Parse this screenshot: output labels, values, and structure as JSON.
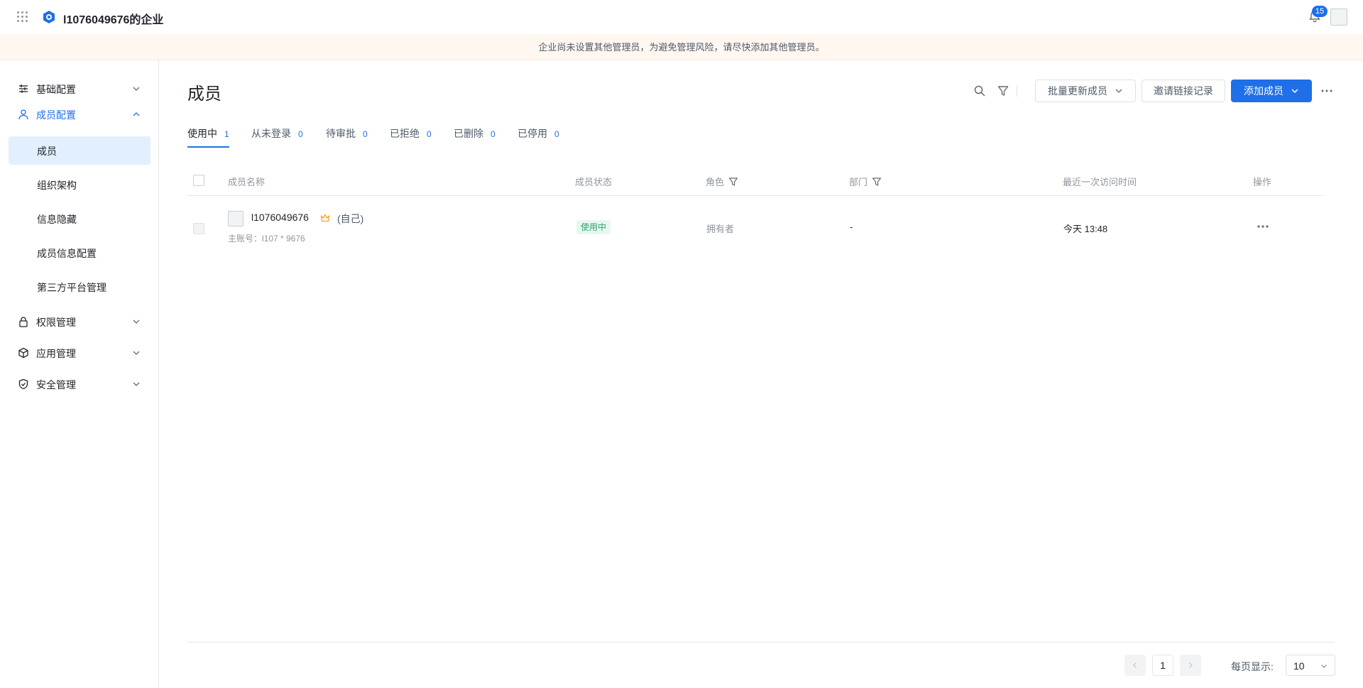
{
  "header": {
    "org_name": "l1076049676的企业",
    "notification_count": "15"
  },
  "banner": {
    "text": "企业尚未设置其他管理员，为避免管理风险，请尽快添加其他管理员。"
  },
  "sidebar": {
    "groups": [
      {
        "label": "基础配置"
      },
      {
        "label": "成员配置"
      },
      {
        "label": "权限管理"
      },
      {
        "label": "应用管理"
      },
      {
        "label": "安全管理"
      }
    ],
    "sub_items": [
      {
        "label": "成员"
      },
      {
        "label": "组织架构"
      },
      {
        "label": "信息隐藏"
      },
      {
        "label": "成员信息配置"
      },
      {
        "label": "第三方平台管理"
      }
    ]
  },
  "main": {
    "title": "成员",
    "buttons": {
      "bulk_update": "批量更新成员",
      "invite_records": "邀请链接记录",
      "add_member": "添加成员"
    },
    "tabs": [
      {
        "label": "使用中",
        "count": "1"
      },
      {
        "label": "从未登录",
        "count": "0"
      },
      {
        "label": "待审批",
        "count": "0"
      },
      {
        "label": "已拒绝",
        "count": "0"
      },
      {
        "label": "已删除",
        "count": "0"
      },
      {
        "label": "已停用",
        "count": "0"
      }
    ],
    "columns": {
      "name": "成员名称",
      "status": "成员状态",
      "role": "角色",
      "department": "部门",
      "last_visit": "最近一次访问时间",
      "actions": "操作"
    },
    "rows": [
      {
        "name": "l1076049676",
        "self_tag": "(自己)",
        "account": "主账号：l107 * 9676",
        "status": "使用中",
        "role": "拥有者",
        "department": "-",
        "last_visit": "今天 13:48"
      }
    ]
  },
  "pagination": {
    "current_page": "1",
    "page_size_label": "每页显示:",
    "page_size": "10"
  },
  "colors": {
    "accent": "#1e6fe8",
    "banner_bg": "#fff7f0",
    "status_green": "#2ba471",
    "crown": "#f5a623"
  }
}
